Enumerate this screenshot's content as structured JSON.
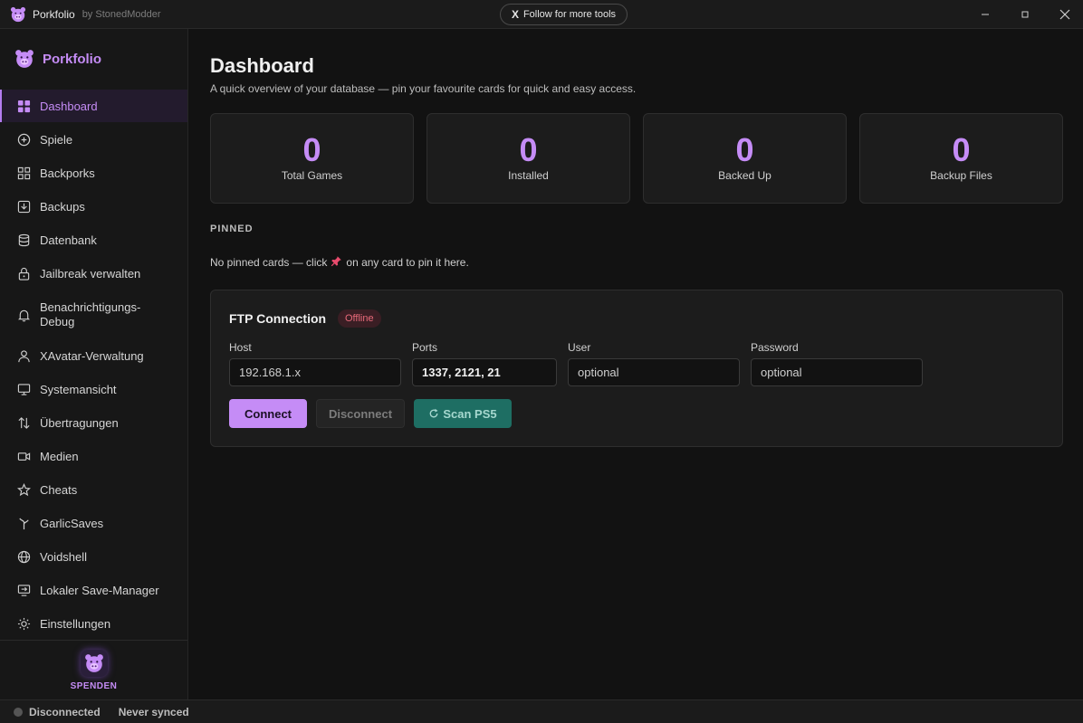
{
  "window": {
    "title": "Porkfolio",
    "byline": "by StonedModder",
    "follow_button": "Follow for more tools",
    "follow_icon": "X"
  },
  "sidebar": {
    "brand": "Porkfolio",
    "items": [
      {
        "label": "Dashboard",
        "icon": "grid-icon"
      },
      {
        "label": "Spiele",
        "icon": "plus-circle-icon"
      },
      {
        "label": "Backporks",
        "icon": "blocks-icon"
      },
      {
        "label": "Backups",
        "icon": "download-box-icon"
      },
      {
        "label": "Datenbank",
        "icon": "database-icon"
      },
      {
        "label": "Jailbreak verwalten",
        "icon": "lock-icon"
      },
      {
        "label": "Benachrichtigungs-Debug",
        "icon": "bell-icon"
      },
      {
        "label": "XAvatar-Verwaltung",
        "icon": "user-icon"
      },
      {
        "label": "Systemansicht",
        "icon": "monitor-icon"
      },
      {
        "label": "Übertragungen",
        "icon": "transfer-icon"
      },
      {
        "label": "Medien",
        "icon": "video-icon"
      },
      {
        "label": "Cheats",
        "icon": "star-icon"
      },
      {
        "label": "GarlicSaves",
        "icon": "garlic-icon"
      },
      {
        "label": "Voidshell",
        "icon": "globe-icon"
      },
      {
        "label": "Lokaler Save-Manager",
        "icon": "screen-share-icon"
      },
      {
        "label": "Einstellungen",
        "icon": "sun-gear-icon"
      }
    ],
    "donate_label": "SPENDEN"
  },
  "main": {
    "title": "Dashboard",
    "subtitle": "A quick overview of your database — pin your favourite cards for quick and easy access.",
    "stats": [
      {
        "value": "0",
        "label": "Total Games"
      },
      {
        "value": "0",
        "label": "Installed"
      },
      {
        "value": "0",
        "label": "Backed Up"
      },
      {
        "value": "0",
        "label": "Backup Files"
      }
    ],
    "pinned_header": "PINNED",
    "pinned_empty_before": "No pinned cards — click",
    "pinned_empty_after": "on any card to pin it here.",
    "ftp": {
      "title": "FTP Connection",
      "badge": "Offline",
      "host_label": "Host",
      "host_placeholder": "192.168.1.x",
      "ports_label": "Ports",
      "ports_value": "1337, 2121, 21",
      "user_label": "User",
      "user_value": "optional",
      "password_label": "Password",
      "password_value": "optional",
      "connect": "Connect",
      "disconnect": "Disconnect",
      "scan": "Scan PS5"
    }
  },
  "status": {
    "connection": "Disconnected",
    "sync": "Never synced"
  },
  "colors": {
    "accent": "#c58cf6",
    "background": "#121212",
    "offline": "#e86a7a",
    "scan": "#1e6e63"
  }
}
